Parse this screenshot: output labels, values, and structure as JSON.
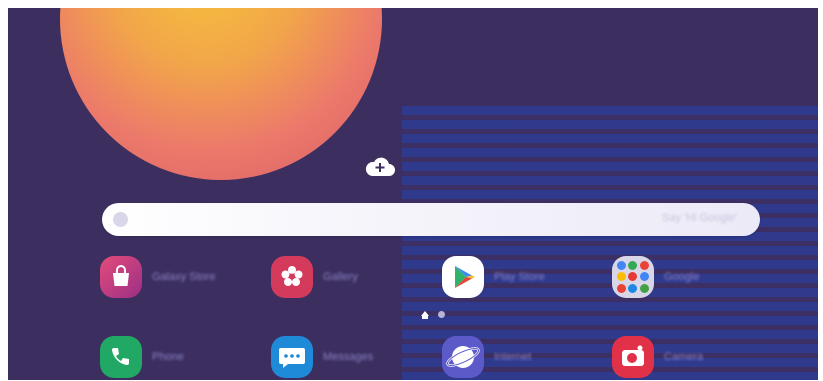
{
  "search": {
    "placeholder": "Say 'Hi Google'",
    "google_icon": "google-g-icon",
    "mic_icon": "mic-icon"
  },
  "widget": {
    "icon": "cloud-add-icon"
  },
  "apps": [
    {
      "label": "Galaxy Store",
      "icon": "shopping-bag-icon",
      "color": "#c4376f"
    },
    {
      "label": "Gallery",
      "icon": "flower-icon",
      "color": "#d33a5a"
    },
    {
      "label": "Play Store",
      "icon": "play-store-icon",
      "color": "#ffffff"
    },
    {
      "label": "Google",
      "icon": "folder-icon",
      "color": "#e8e6f0"
    },
    {
      "label": "Phone",
      "icon": "phone-icon",
      "color": "#1fa463"
    },
    {
      "label": "Messages",
      "icon": "messages-icon",
      "color": "#1f88d8"
    },
    {
      "label": "Internet",
      "icon": "internet-icon",
      "color": "#5a58c8"
    },
    {
      "label": "Camera",
      "icon": "camera-icon",
      "color": "#e0304a"
    }
  ],
  "pager": {
    "pages": 2,
    "current": 1
  }
}
